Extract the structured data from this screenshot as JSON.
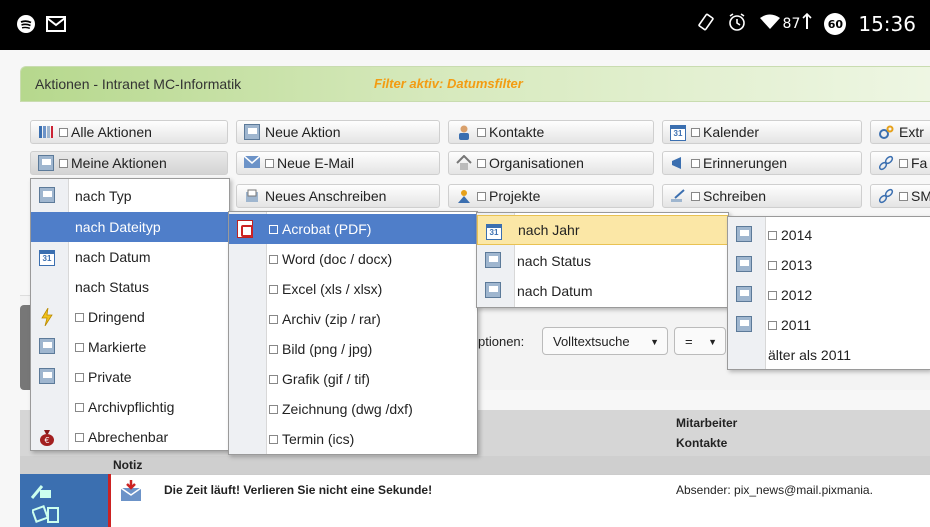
{
  "statusbar": {
    "time": "15:36",
    "battery_badge": "60",
    "signal_text": "87",
    "icons": [
      "spotify-icon",
      "gmail-icon",
      "rotate-icon",
      "alarm-icon",
      "wifi-icon",
      "signal-icon",
      "battery-icon"
    ]
  },
  "header": {
    "title": "Aktionen - Intranet MC-Informatik",
    "filter": "Filter aktiv: Datumsfilter"
  },
  "nav": {
    "col1": [
      "Alle Aktionen",
      "Meine Aktionen"
    ],
    "col2": [
      "Neue Aktion",
      "Neue E-Mail",
      "Neues Anschreiben"
    ],
    "col3": [
      "Kontakte",
      "Organisationen",
      "Projekte"
    ],
    "col4": [
      "Kalender",
      "Erinnerungen",
      "Schreiben"
    ],
    "col5": [
      "Extr",
      "Fa",
      "SM"
    ]
  },
  "menu_main": [
    {
      "label": "nach Typ",
      "icon": "edit-icon"
    },
    {
      "label": "nach Dateityp",
      "icon": ""
    },
    {
      "label": "nach Datum",
      "icon": "calendar-icon"
    },
    {
      "label": "nach Status",
      "icon": ""
    },
    {
      "label": "Dringend",
      "icon": "lightning-icon"
    },
    {
      "label": "Markierte",
      "icon": "edit-icon"
    },
    {
      "label": "Private",
      "icon": "edit-icon"
    },
    {
      "label": "Archivpflichtig",
      "icon": ""
    },
    {
      "label": "Abrechenbar",
      "icon": "money-bag-icon"
    }
  ],
  "menu_filetype": [
    "Acrobat (PDF)",
    "Word (doc / docx)",
    "Excel (xls / xlsx)",
    "Archiv (zip / rar)",
    "Bild (png / jpg)",
    "Grafik (gif / tif)",
    "Zeichnung (dwg /dxf)",
    "Termin (ics)"
  ],
  "menu_pdf": [
    "nach Jahr",
    "nach Status",
    "nach Datum"
  ],
  "menu_year": [
    "2014",
    "2013",
    "2012",
    "2011",
    "älter als 2011"
  ],
  "options": {
    "label": "ptionen:",
    "search_mode": "Volltextsuche",
    "operator": "="
  },
  "table": {
    "col_mitarbeiter": "Mitarbeiter",
    "col_kontakte": "Kontakte",
    "col_notiz": "Notiz",
    "row1_subject": "Die Zeit läuft! Verlieren Sie nicht eine Sekunde!",
    "row1_sender": "Absender: pix_news@mail.pixmania."
  },
  "colors": {
    "selected": "#4f7ec9",
    "hover": "#fbe7a6",
    "filter_text": "#f39c12",
    "header_green": "#b6d88d"
  }
}
